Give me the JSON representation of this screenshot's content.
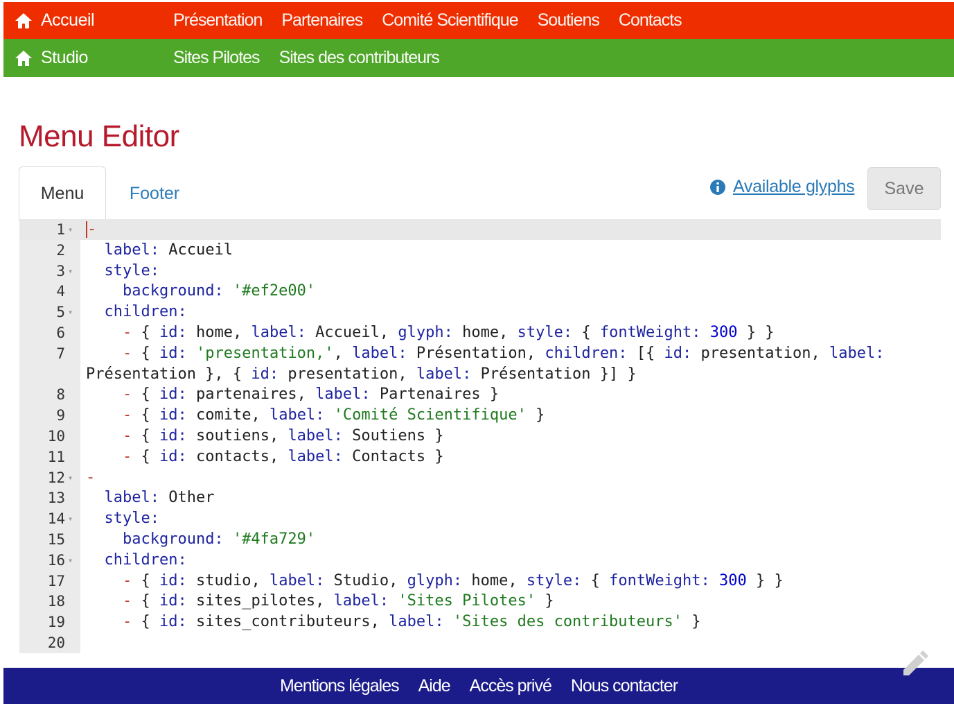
{
  "nav_primary": {
    "brand": "Accueil",
    "color": "#ef2e00",
    "links": [
      "Présentation",
      "Partenaires",
      "Comité Scientifique",
      "Soutiens",
      "Contacts"
    ]
  },
  "nav_secondary": {
    "brand": "Studio",
    "color": "#4fa729",
    "links": [
      "Sites Pilotes",
      "Sites des contributeurs"
    ]
  },
  "page": {
    "title": "Menu Editor",
    "tabs": [
      "Menu",
      "Footer"
    ],
    "active_tab": "Menu",
    "glyphs_link": "Available glyphs",
    "save_label": "Save"
  },
  "editor": {
    "lines": [
      {
        "n": "1",
        "fold": true,
        "html": "<span class=\"cursor\"></span><span class=\"d\">-</span>"
      },
      {
        "n": "2",
        "fold": false,
        "html": "  <span class=\"k\">label:</span> Accueil"
      },
      {
        "n": "3",
        "fold": true,
        "html": "  <span class=\"k\">style:</span>"
      },
      {
        "n": "4",
        "fold": false,
        "html": "    <span class=\"k\">background:</span> <span class=\"s\">'#ef2e00'</span>"
      },
      {
        "n": "5",
        "fold": true,
        "html": "  <span class=\"k\">children:</span>"
      },
      {
        "n": "6",
        "fold": false,
        "html": "    <span class=\"d\">-</span> { <span class=\"k\">id:</span> home, <span class=\"k\">label:</span> Accueil, <span class=\"k\">glyph:</span> home, <span class=\"k\">style:</span> { <span class=\"k\">fontWeight:</span> <span class=\"n\">300</span> } }"
      },
      {
        "n": "7",
        "fold": false,
        "html": "    <span class=\"d\">-</span> { <span class=\"k\">id:</span> <span class=\"s\">'presentation,'</span>, <span class=\"k\">label:</span> Présentation, <span class=\"k\">children:</span> [{ <span class=\"k\">id:</span> presentation, <span class=\"k\">label:</span>"
      },
      {
        "n": "",
        "fold": false,
        "wrap": true,
        "html": "Présentation }, { <span class=\"k\">id:</span> presentation, <span class=\"k\">label:</span> Présentation }] }"
      },
      {
        "n": "8",
        "fold": false,
        "html": "    <span class=\"d\">-</span> { <span class=\"k\">id:</span> partenaires, <span class=\"k\">label:</span> Partenaires }"
      },
      {
        "n": "9",
        "fold": false,
        "html": "    <span class=\"d\">-</span> { <span class=\"k\">id:</span> comite, <span class=\"k\">label:</span> <span class=\"s\">'Comité Scientifique'</span> }"
      },
      {
        "n": "10",
        "fold": false,
        "html": "    <span class=\"d\">-</span> { <span class=\"k\">id:</span> soutiens, <span class=\"k\">label:</span> Soutiens }"
      },
      {
        "n": "11",
        "fold": false,
        "html": "    <span class=\"d\">-</span> { <span class=\"k\">id:</span> contacts, <span class=\"k\">label:</span> Contacts }"
      },
      {
        "n": "12",
        "fold": true,
        "html": "<span class=\"d\">-</span>"
      },
      {
        "n": "13",
        "fold": false,
        "html": "  <span class=\"k\">label:</span> Other"
      },
      {
        "n": "14",
        "fold": true,
        "html": "  <span class=\"k\">style:</span>"
      },
      {
        "n": "15",
        "fold": false,
        "html": "    <span class=\"k\">background:</span> <span class=\"s\">'#4fa729'</span>"
      },
      {
        "n": "16",
        "fold": true,
        "html": "  <span class=\"k\">children:</span>"
      },
      {
        "n": "17",
        "fold": false,
        "html": "    <span class=\"d\">-</span> { <span class=\"k\">id:</span> studio, <span class=\"k\">label:</span> Studio, <span class=\"k\">glyph:</span> home, <span class=\"k\">style:</span> { <span class=\"k\">fontWeight:</span> <span class=\"n\">300</span> } }"
      },
      {
        "n": "18",
        "fold": false,
        "html": "    <span class=\"d\">-</span> { <span class=\"k\">id:</span> sites_pilotes, <span class=\"k\">label:</span> <span class=\"s\">'Sites Pilotes'</span> }"
      },
      {
        "n": "19",
        "fold": false,
        "html": "    <span class=\"d\">-</span> { <span class=\"k\">id:</span> sites_contributeurs, <span class=\"k\">label:</span> <span class=\"s\">'Sites des contributeurs'</span> }"
      },
      {
        "n": "20",
        "fold": false,
        "html": ""
      }
    ]
  },
  "footer": {
    "color": "#1b1b8a",
    "links": [
      "Mentions légales",
      "Aide",
      "Accès privé",
      "Nous contacter"
    ]
  }
}
